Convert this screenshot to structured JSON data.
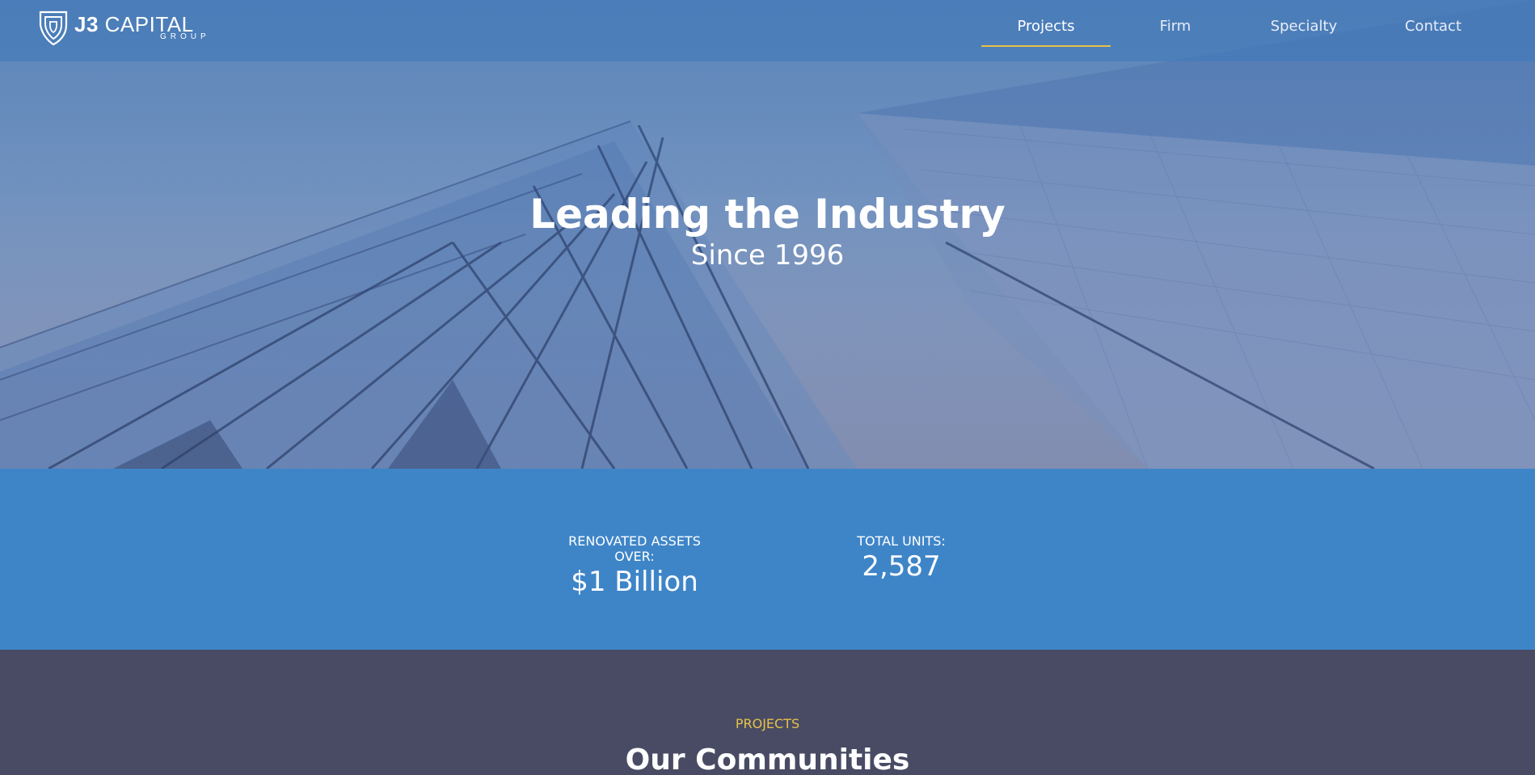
{
  "brand": {
    "name_bold": "J3",
    "name_rest": "CAPITAL",
    "subtitle": "GROUP"
  },
  "nav": {
    "items": [
      {
        "label": "Projects",
        "active": true
      },
      {
        "label": "Firm",
        "active": false
      },
      {
        "label": "Specialty",
        "active": false
      },
      {
        "label": "Contact",
        "active": false
      }
    ]
  },
  "hero": {
    "title": "Leading the Industry",
    "subtitle": "Since 1996"
  },
  "stats": [
    {
      "label": "RENOVATED ASSETS OVER:",
      "value": "$1 Billion"
    },
    {
      "label": "TOTAL UNITS:",
      "value": "2,587"
    }
  ],
  "projects": {
    "kicker": "PROJECTS",
    "title": "Our Communities"
  },
  "colors": {
    "accent": "#e8c14a",
    "stats_bg": "#3e85c8",
    "projects_bg": "#484b63"
  }
}
